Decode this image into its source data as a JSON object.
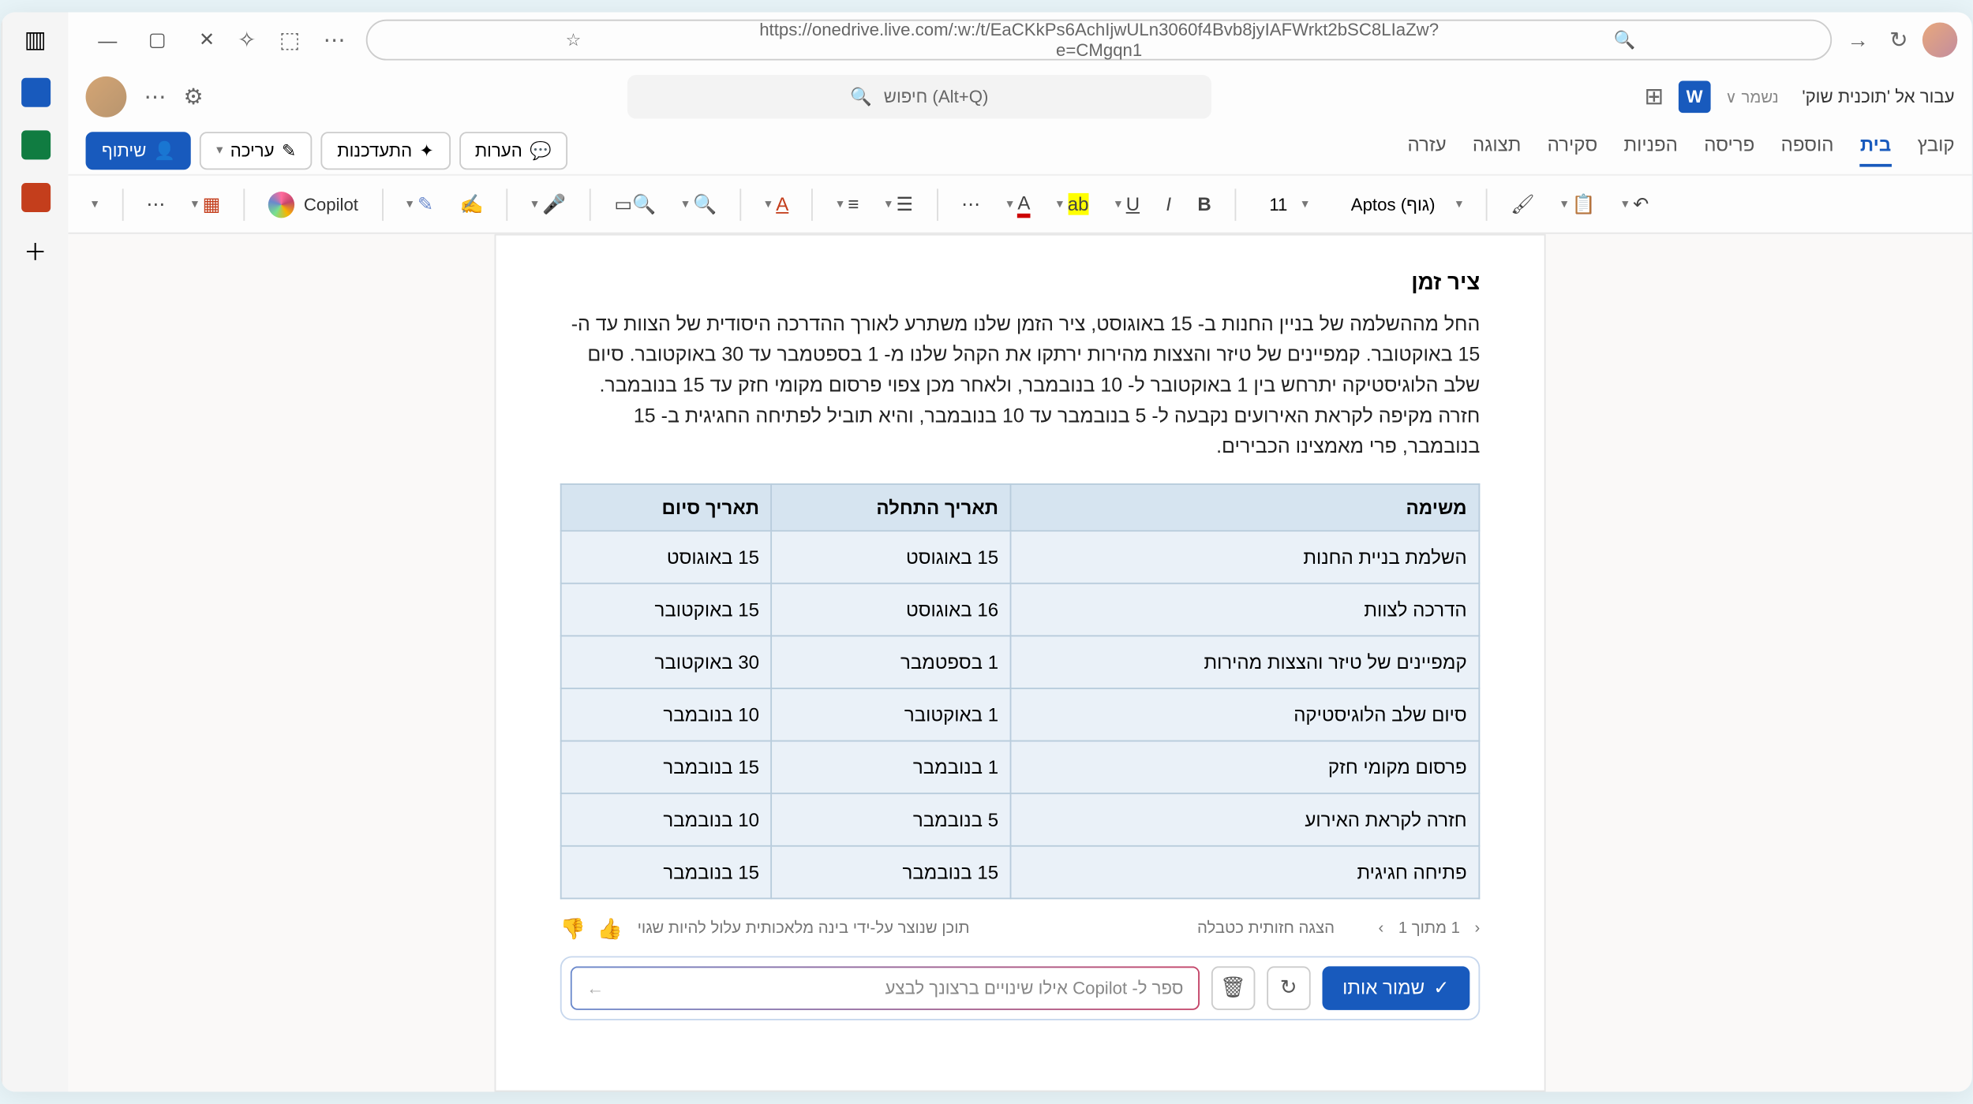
{
  "browser": {
    "url": "https://onedrive.live.com/:w:/t/EaCKkPs6AchIjwULn3060f4Bvb8jyIAFWrkt2bSC8LIaZw?e=CMgqn1"
  },
  "header": {
    "search_placeholder": "(Alt+Q) חיפוש",
    "doc_prefix": "עבור אל ",
    "doc_name": "'תוכנית שוק'",
    "saved": "נשמר ∨"
  },
  "actions": {
    "share": "שיתוף",
    "edit": "עריכה",
    "catchup": "התעדכנות",
    "comments": "הערות"
  },
  "tabs": [
    "קובץ",
    "בית",
    "הוספה",
    "פריסה",
    "הפניות",
    "סקירה",
    "תצוגה",
    "עזרה"
  ],
  "active_tab": "בית",
  "ribbon": {
    "font_name": "(גוף) Aptos",
    "font_size": "11",
    "copilot": "Copilot"
  },
  "document": {
    "heading": "ציר זמן",
    "paragraph": "החל מההשלמה של בניין החנות ב- 15 באוגוסט, ציר הזמן שלנו משתרע לאורך ההדרכה היסודית של הצוות עד ה- 15 באוקטובר. קמפיינים של טיזר והצצות מהירות ירתקו את הקהל שלנו מ- 1 בספטמבר עד 30 באוקטובר. סיום שלב הלוגיסטיקה יתרחש בין 1 באוקטובר ל- 10 בנובמבר, ולאחר מכן צפוי פרסום מקומי חזק עד 15 בנובמבר. חזרה מקיפה לקראת האירועים נקבעה ל- 5 בנובמבר עד 10 בנובמבר, והיא תוביל לפתיחה החגיגית ב- 15 בנובמבר, פרי מאמצינו הכבירים.",
    "columns": [
      "משימה",
      "תאריך התחלה",
      "תאריך סיום"
    ],
    "rows": [
      [
        "השלמת בניית החנות",
        "15 באוגוסט",
        "15 באוגוסט"
      ],
      [
        "הדרכה לצוות",
        "16 באוגוסט",
        "15 באוקטובר"
      ],
      [
        "קמפיינים של טיזר והצצות מהירות",
        "1 בספטמבר",
        "30 באוקטובר"
      ],
      [
        "סיום שלב הלוגיסטיקה",
        "1 באוקטובר",
        "10 בנובמבר"
      ],
      [
        "פרסום מקומי חזק",
        "1 בנובמבר",
        "15 בנובמבר"
      ],
      [
        "חזרה לקראת האירוע",
        "5 בנובמבר",
        "10 בנובמבר"
      ],
      [
        "פתיחה חגיגית",
        "15 בנובמבר",
        "15 בנובמבר"
      ]
    ]
  },
  "copilot_panel": {
    "counter": "1 מתוך 1",
    "view_as_table": "הצגה חזותית כטבלה",
    "disclaimer": "תוכן שנוצר על-ידי בינה מלאכותית עלול להיות שגוי",
    "keep_it": "שמור אותו",
    "input_placeholder": "ספר ל- Copilot אילו שינויים ברצונך לבצע"
  }
}
